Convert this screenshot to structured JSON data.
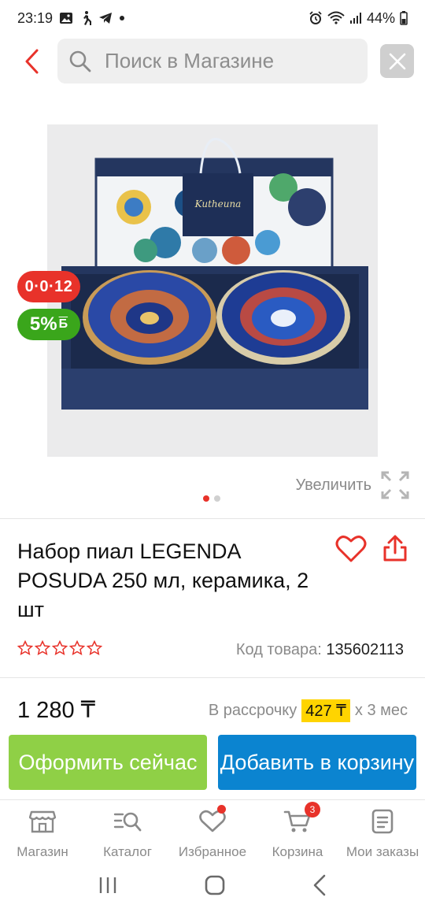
{
  "status_bar": {
    "time": "23:19",
    "battery": "44%",
    "icons": [
      "gallery-icon",
      "walking-icon",
      "telegram-icon",
      "dot-icon",
      "alarm-icon",
      "wifi-icon",
      "signal-icon",
      "battery-icon"
    ]
  },
  "search": {
    "placeholder": "Поиск в Магазине"
  },
  "product": {
    "badge_installment": "0·0·12",
    "badge_bonus": "5%",
    "badge_bonus_suffix": "Б",
    "zoom_label": "Увеличить",
    "gallery_count": 2,
    "gallery_active": 1,
    "title": "Набор пиал LEGENDA POSUDA 250 мл, керамика, 2 шт",
    "rating_stars": 0,
    "code_label": "Код товара:",
    "code_value": "135602113",
    "price": "1 280 ₸",
    "installment_prefix": "В рассрочку",
    "installment_amount": "427 ₸",
    "installment_suffix": "х 3 мес"
  },
  "actions": {
    "order_now": "Оформить сейчас",
    "add_to_cart": "Добавить в корзину"
  },
  "bottom_nav": {
    "items": [
      {
        "label": "Магазин",
        "icon": "store-icon"
      },
      {
        "label": "Каталог",
        "icon": "catalog-search-icon"
      },
      {
        "label": "Избранное",
        "icon": "heart-icon"
      },
      {
        "label": "Корзина",
        "icon": "cart-icon",
        "badge": "3"
      },
      {
        "label": "Мои заказы",
        "icon": "orders-icon"
      }
    ]
  },
  "colors": {
    "accent_red": "#e8322a",
    "order_green": "#8fd046",
    "cart_blue": "#0b84d0",
    "bonus_green": "#3aa61b",
    "installment_yellow": "#ffd400"
  }
}
